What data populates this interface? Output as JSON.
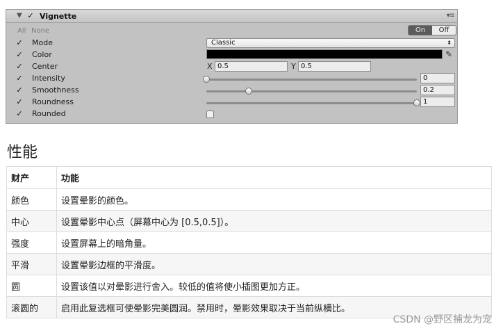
{
  "inspector": {
    "title": "Vignette",
    "all_label": "All",
    "none_label": "None",
    "toggle_on": "On",
    "toggle_off": "Off",
    "rows": {
      "mode": {
        "label": "Mode",
        "value": "Classic"
      },
      "color": {
        "label": "Color",
        "value": "#000000"
      },
      "center": {
        "label": "Center",
        "x_label": "X",
        "x_value": "0.5",
        "y_label": "Y",
        "y_value": "0.5"
      },
      "intensity": {
        "label": "Intensity",
        "value": "0",
        "level": 0.0
      },
      "smoothness": {
        "label": "Smoothness",
        "value": "0.2",
        "level": 0.2
      },
      "roundness": {
        "label": "Roundness",
        "value": "1",
        "level": 1.0
      },
      "rounded": {
        "label": "Rounded",
        "checked": false
      }
    }
  },
  "doc": {
    "section_title": "性能",
    "table": {
      "headers": [
        "财产",
        "功能"
      ],
      "rows": [
        [
          "颜色",
          "设置晕影的颜色。"
        ],
        [
          "中心",
          "设置晕影中心点（屏幕中心为 [0.5,0.5]）。"
        ],
        [
          "强度",
          "设置屏幕上的暗角量。"
        ],
        [
          "平滑",
          "设置晕影边框的平滑度。"
        ],
        [
          "圆",
          "设置该值以对晕影进行舍入。较低的值将使小插图更加方正。"
        ],
        [
          "滚圆的",
          "启用此复选框可使晕影完美圆润。禁用时，晕影效果取决于当前纵横比。"
        ]
      ]
    }
  },
  "watermark": "CSDN @野区捕龙为宠",
  "icons": [
    "foldout-arrow-icon",
    "checkbox-checked-icon",
    "menu-icon",
    "dropdown-arrows-icon",
    "eyedropper-icon",
    "slider-thumb-icon"
  ]
}
